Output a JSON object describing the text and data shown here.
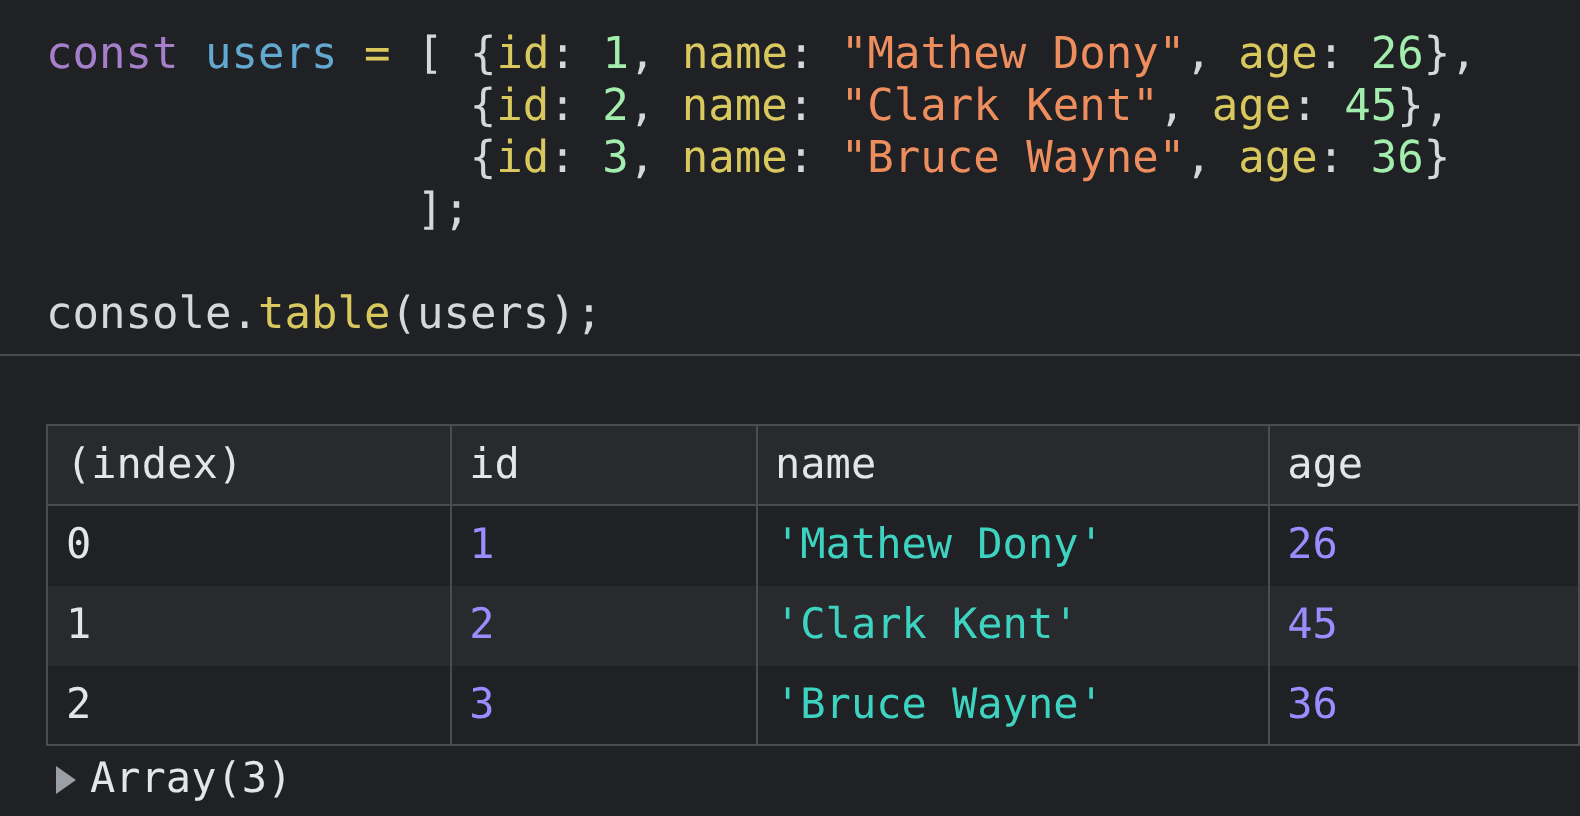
{
  "code_lines": [
    {
      "kind": "first",
      "tokens": [
        {
          "text": "const ",
          "kind": "keyword"
        },
        {
          "text": "users",
          "kind": "variable"
        },
        {
          "text": " = ",
          "kind": "operator"
        },
        {
          "text": "[ {",
          "kind": "punct"
        },
        {
          "text": "id",
          "kind": "property"
        },
        {
          "text": ": ",
          "kind": "punct"
        },
        {
          "text": "1",
          "kind": "number"
        },
        {
          "text": ", ",
          "kind": "punct"
        },
        {
          "text": "name",
          "kind": "property"
        },
        {
          "text": ": ",
          "kind": "punct"
        },
        {
          "text": "\"Mathew Dony\"",
          "kind": "string"
        },
        {
          "text": ", ",
          "kind": "punct"
        },
        {
          "text": "age",
          "kind": "property"
        },
        {
          "text": ": ",
          "kind": "punct"
        },
        {
          "text": "26",
          "kind": "number"
        },
        {
          "text": "},",
          "kind": "punct"
        }
      ]
    },
    {
      "kind": "continuation",
      "tokens": [
        {
          "text": "{",
          "kind": "punct"
        },
        {
          "text": "id",
          "kind": "property"
        },
        {
          "text": ": ",
          "kind": "punct"
        },
        {
          "text": "2",
          "kind": "number"
        },
        {
          "text": ", ",
          "kind": "punct"
        },
        {
          "text": "name",
          "kind": "property"
        },
        {
          "text": ": ",
          "kind": "punct"
        },
        {
          "text": "\"Clark Kent\"",
          "kind": "string"
        },
        {
          "text": ", ",
          "kind": "punct"
        },
        {
          "text": "age",
          "kind": "property"
        },
        {
          "text": ": ",
          "kind": "punct"
        },
        {
          "text": "45",
          "kind": "number"
        },
        {
          "text": "},",
          "kind": "punct"
        }
      ]
    },
    {
      "kind": "continuation",
      "tokens": [
        {
          "text": "{",
          "kind": "punct"
        },
        {
          "text": "id",
          "kind": "property"
        },
        {
          "text": ": ",
          "kind": "punct"
        },
        {
          "text": "3",
          "kind": "number"
        },
        {
          "text": ", ",
          "kind": "punct"
        },
        {
          "text": "name",
          "kind": "property"
        },
        {
          "text": ": ",
          "kind": "punct"
        },
        {
          "text": "\"Bruce Wayne\"",
          "kind": "string"
        },
        {
          "text": ", ",
          "kind": "punct"
        },
        {
          "text": "age",
          "kind": "property"
        },
        {
          "text": ": ",
          "kind": "punct"
        },
        {
          "text": "36",
          "kind": "number"
        },
        {
          "text": "}",
          "kind": "punct"
        }
      ]
    },
    {
      "kind": "closing",
      "tokens": [
        {
          "text": "];",
          "kind": "punct"
        }
      ]
    },
    {
      "kind": "statement",
      "tokens": [
        {
          "text": "console.",
          "kind": "punct"
        },
        {
          "text": "table",
          "kind": "method"
        },
        {
          "text": "(users);",
          "kind": "punct"
        }
      ]
    }
  ],
  "table": {
    "columns": [
      "(index)",
      "id",
      "name",
      "age"
    ],
    "rows": [
      {
        "cells": [
          {
            "text": "0",
            "kind": "index"
          },
          {
            "text": "1",
            "kind": "number"
          },
          {
            "text": "'Mathew Dony'",
            "kind": "string"
          },
          {
            "text": "26",
            "kind": "number"
          }
        ]
      },
      {
        "cells": [
          {
            "text": "1",
            "kind": "index"
          },
          {
            "text": "2",
            "kind": "number"
          },
          {
            "text": "'Clark Kent'",
            "kind": "string"
          },
          {
            "text": "45",
            "kind": "number"
          }
        ]
      },
      {
        "cells": [
          {
            "text": "2",
            "kind": "index"
          },
          {
            "text": "3",
            "kind": "number"
          },
          {
            "text": "'Bruce Wayne'",
            "kind": "string"
          },
          {
            "text": "36",
            "kind": "number"
          }
        ]
      }
    ]
  },
  "summary": {
    "text": "Array(3)",
    "expanded": false
  }
}
